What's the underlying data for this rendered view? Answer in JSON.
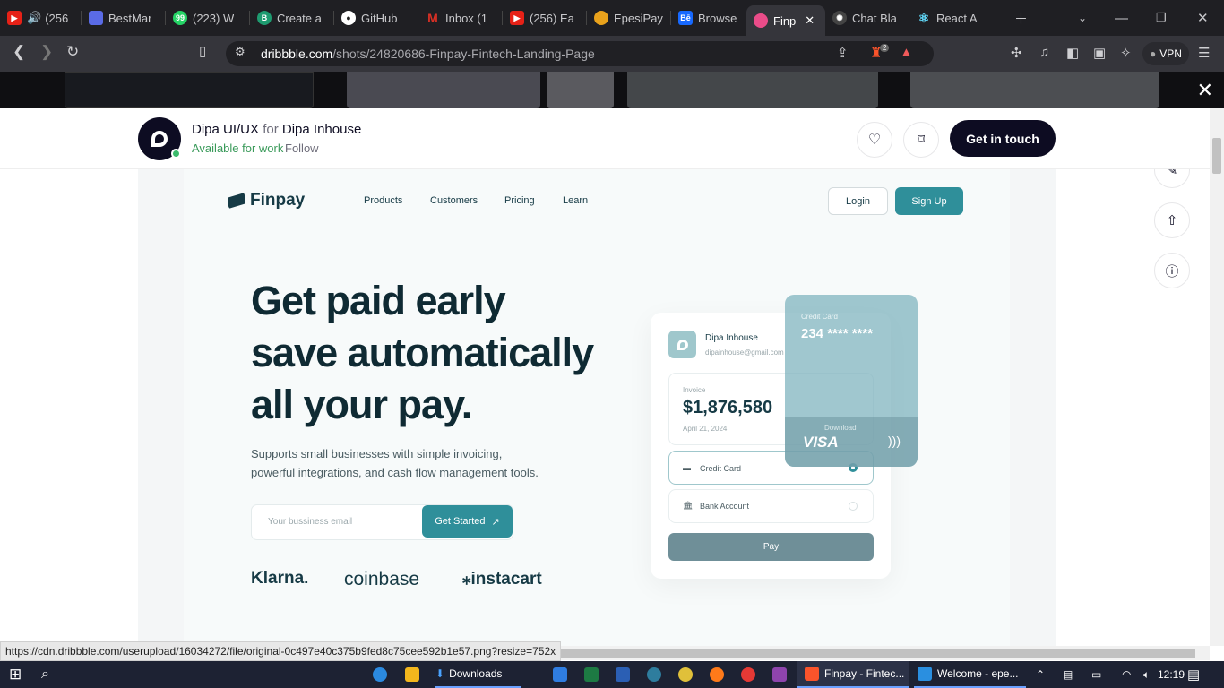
{
  "browser": {
    "tabs": [
      {
        "title": "(256",
        "color": "#e62117",
        "icon": "youtube-icon"
      },
      {
        "title": "BestMar",
        "color": "#5a6be6",
        "icon": "app-icon"
      },
      {
        "title": "(223) W",
        "color": "#25d366",
        "icon": "whatsapp-icon"
      },
      {
        "title": "Create a",
        "color": "#1e9b70",
        "icon": "b-icon"
      },
      {
        "title": "GitHub",
        "color": "#222222",
        "icon": "github-icon"
      },
      {
        "title": "Inbox (1",
        "color": "#d93025",
        "icon": "gmail-icon"
      },
      {
        "title": "(256) Ea",
        "color": "#e62117",
        "icon": "youtube-icon"
      },
      {
        "title": "EpesiPay",
        "color": "#e9a21c",
        "icon": "coin-icon"
      },
      {
        "title": "Browse",
        "color": "#1769ff",
        "icon": "behance-icon"
      },
      {
        "title": "Finp",
        "color": "#ea4c89",
        "icon": "dribbble-icon"
      },
      {
        "title": "Chat Bla",
        "color": "#444444",
        "icon": "openai-icon"
      },
      {
        "title": "React Ap",
        "color": "#61dafb",
        "icon": "react-icon"
      }
    ],
    "url_host": "dribbble.com",
    "url_path": "/shots/24820686-Finpay-Fintech-Landing-Page",
    "vpn_label": "VPN",
    "brave_badge": "2",
    "status_url": "https://cdn.dribbble.com/userupload/16034272/file/original-0c497e40c375b9fed8c75cee592b1e57.png?resize=752x"
  },
  "shot_header": {
    "author": "Dipa UI/UX",
    "for_label": "for",
    "team": "Dipa Inhouse",
    "available": "Available for work",
    "follow": "Follow",
    "cta": "Get in touch"
  },
  "finpay": {
    "logo": "Finpay",
    "nav": [
      "Products",
      "Customers",
      "Pricing",
      "Learn"
    ],
    "login": "Login",
    "signup": "Sign Up",
    "hero_lines": [
      "Get paid early",
      "save automatically",
      "all your pay."
    ],
    "sub_lines": [
      "Supports small businesses with simple invoicing,",
      "powerful integrations, and cash flow management tools."
    ],
    "email_placeholder": "Your bussiness email",
    "get_started": "Get Started",
    "brands": [
      "Klarna.",
      "coinbase",
      "instacart"
    ],
    "card": {
      "name": "Dipa Inhouse",
      "email": "dipainhouse@gmail.com",
      "invoice_label": "Invoice",
      "invoice_amount": "$1,876,580",
      "invoice_date": "April 21, 2024",
      "option_credit": "Credit Card",
      "option_bank": "Bank Account",
      "pay": "Pay",
      "cc_label": "Credit Card",
      "cc_number": "234 **** ****",
      "cc_brand": "VISA",
      "download": "Download"
    }
  },
  "taskbar": {
    "downloads": "Downloads",
    "brave_task": "Finpay - Fintec...",
    "vscode_task": "Welcome - epe...",
    "time": "12:19"
  }
}
